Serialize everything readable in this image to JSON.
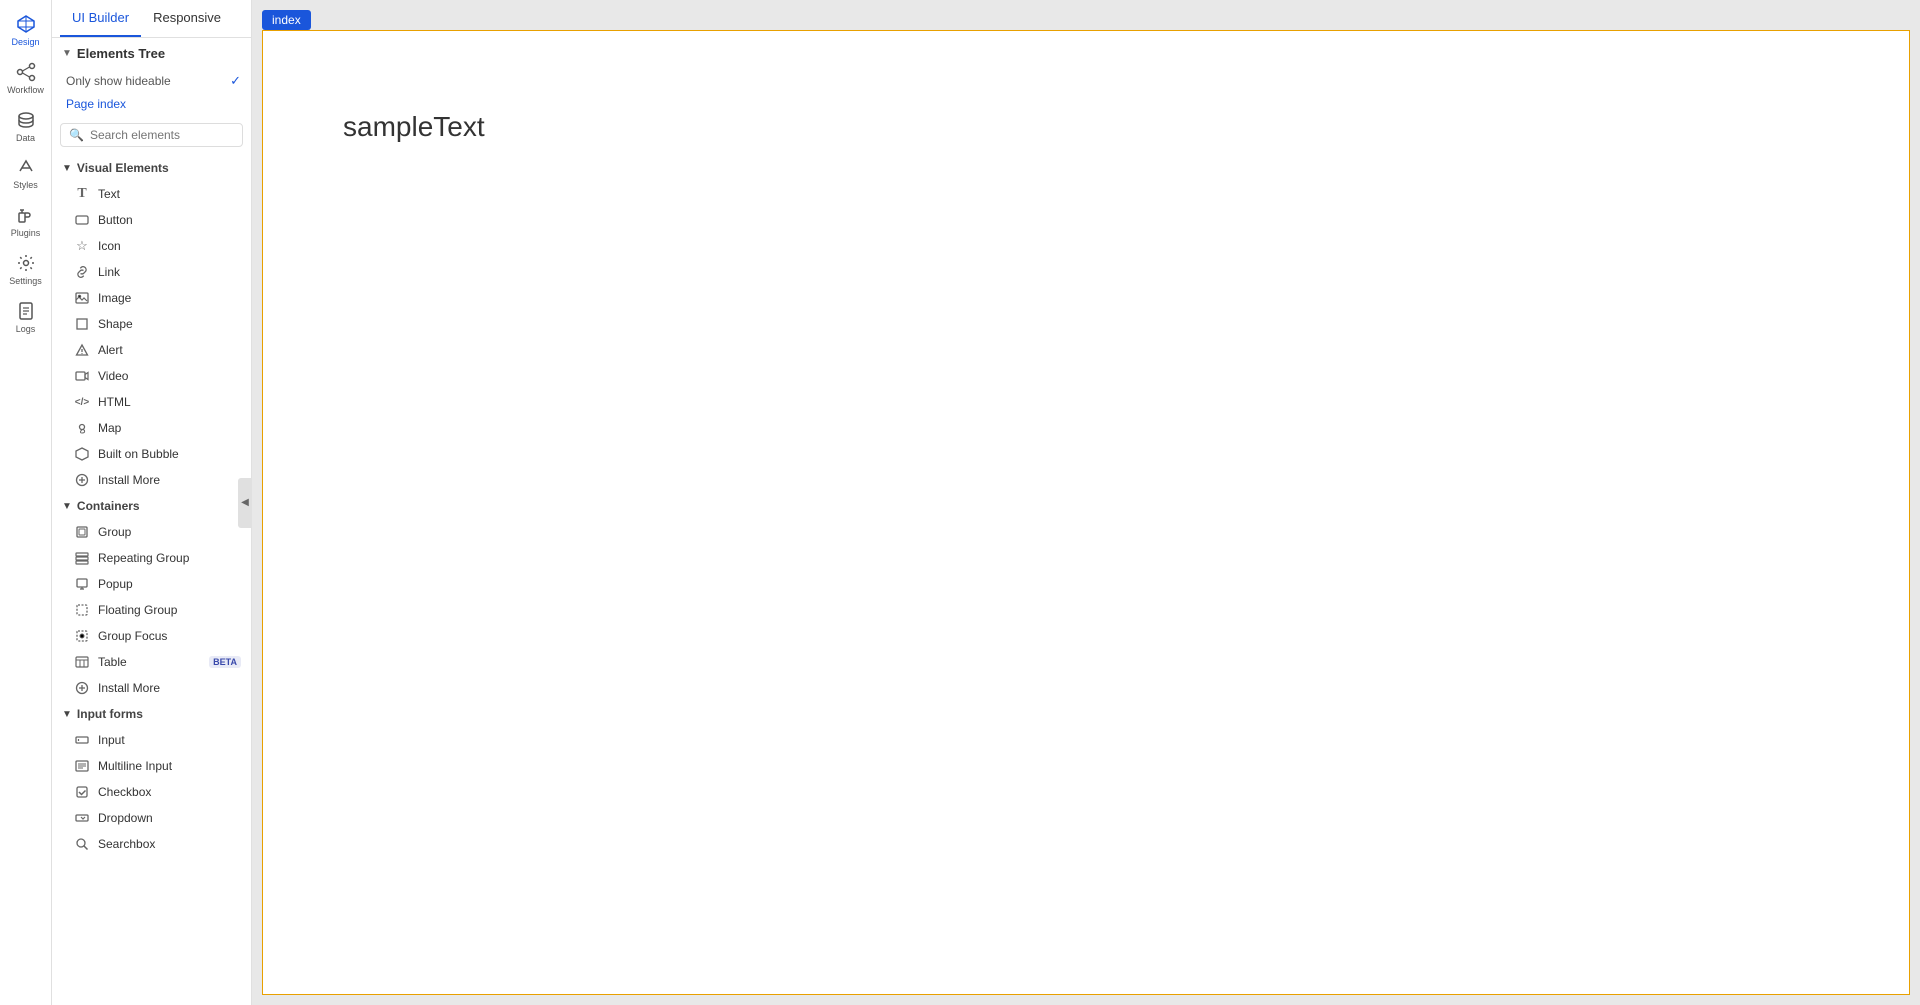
{
  "iconSidebar": {
    "items": [
      {
        "id": "design",
        "label": "Design",
        "icon": "⬡",
        "active": true
      },
      {
        "id": "workflow",
        "label": "Workflow",
        "icon": "⚡",
        "active": false
      },
      {
        "id": "data",
        "label": "Data",
        "icon": "🗄",
        "active": false
      },
      {
        "id": "styles",
        "label": "Styles",
        "icon": "✏️",
        "active": false
      },
      {
        "id": "plugins",
        "label": "Plugins",
        "icon": "🔌",
        "active": false
      },
      {
        "id": "settings",
        "label": "Settings",
        "icon": "⚙",
        "active": false
      },
      {
        "id": "logs",
        "label": "Logs",
        "icon": "📄",
        "active": false
      }
    ]
  },
  "topTabs": {
    "tabs": [
      {
        "id": "ui-builder",
        "label": "UI Builder",
        "active": true
      },
      {
        "id": "responsive",
        "label": "Responsive",
        "active": false
      }
    ]
  },
  "elementsTree": {
    "header": "Elements Tree",
    "hideableLabel": "Only show hideable",
    "hideableChecked": true,
    "pageIndexLabel": "Page index",
    "searchPlaceholder": "Search elements"
  },
  "visualElements": {
    "header": "Visual Elements",
    "items": [
      {
        "id": "text",
        "label": "Text",
        "icon": "T"
      },
      {
        "id": "button",
        "label": "Button",
        "icon": "⬜"
      },
      {
        "id": "icon",
        "label": "Icon",
        "icon": "☆"
      },
      {
        "id": "link",
        "label": "Link",
        "icon": "🔗"
      },
      {
        "id": "image",
        "label": "Image",
        "icon": "🖼"
      },
      {
        "id": "shape",
        "label": "Shape",
        "icon": "⬜"
      },
      {
        "id": "alert",
        "label": "Alert",
        "icon": "⚠"
      },
      {
        "id": "video",
        "label": "Video",
        "icon": "▶"
      },
      {
        "id": "html",
        "label": "HTML",
        "icon": "</>"
      },
      {
        "id": "map",
        "label": "Map",
        "icon": "📍"
      },
      {
        "id": "built-on-bubble",
        "label": "Built on Bubble",
        "icon": "⬡"
      },
      {
        "id": "install-more-visual",
        "label": "Install More",
        "icon": "⊕"
      }
    ]
  },
  "containers": {
    "header": "Containers",
    "items": [
      {
        "id": "group",
        "label": "Group",
        "icon": "▣",
        "beta": false
      },
      {
        "id": "repeating-group",
        "label": "Repeating Group",
        "icon": "▤",
        "beta": false
      },
      {
        "id": "popup",
        "label": "Popup",
        "icon": "⬜",
        "beta": false
      },
      {
        "id": "floating-group",
        "label": "Floating Group",
        "icon": "⬚",
        "beta": false
      },
      {
        "id": "group-focus",
        "label": "Group Focus",
        "icon": "⬚",
        "beta": false
      },
      {
        "id": "table",
        "label": "Table",
        "icon": "▦",
        "beta": true
      },
      {
        "id": "install-more-containers",
        "label": "Install More",
        "icon": "⊕",
        "beta": false
      }
    ]
  },
  "inputForms": {
    "header": "Input forms",
    "items": [
      {
        "id": "input",
        "label": "Input",
        "icon": "▭"
      },
      {
        "id": "multiline-input",
        "label": "Multiline Input",
        "icon": "▭"
      },
      {
        "id": "checkbox",
        "label": "Checkbox",
        "icon": "☑"
      },
      {
        "id": "dropdown",
        "label": "Dropdown",
        "icon": "▾"
      },
      {
        "id": "searchbox",
        "label": "Searchbox",
        "icon": "🔍"
      }
    ]
  },
  "canvas": {
    "tabLabel": "index",
    "sampleText": "sampleText"
  },
  "betaLabel": "BETA"
}
